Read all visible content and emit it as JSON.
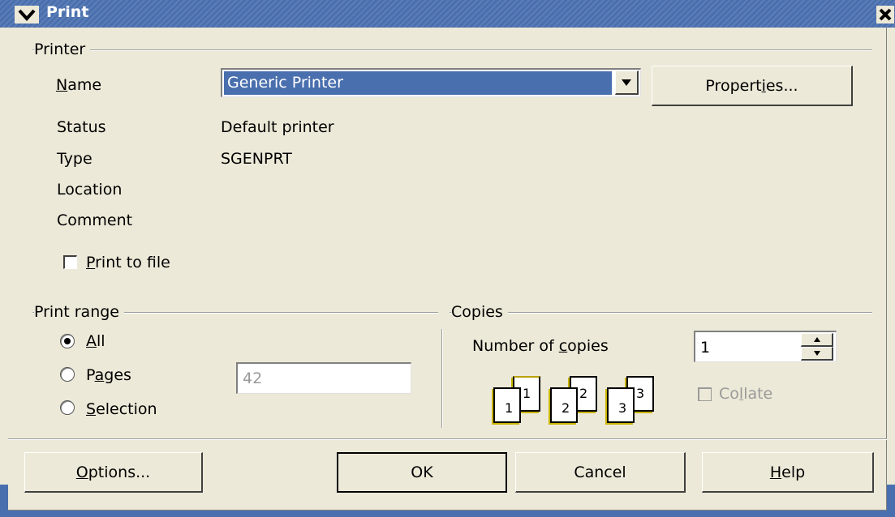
{
  "window": {
    "title": "Print"
  },
  "printer": {
    "group_label": "Printer",
    "name_label": "Name",
    "name_value": "Generic Printer",
    "properties_button": "Properties...",
    "status_label": "Status",
    "status_value": "Default printer",
    "type_label": "Type",
    "type_value": "SGENPRT",
    "location_label": "Location",
    "comment_label": "Comment",
    "print_to_file_label": "Print to file",
    "print_to_file_checked": false
  },
  "print_range": {
    "group_label": "Print range",
    "options": [
      {
        "label": "All",
        "selected": true
      },
      {
        "label": "Pages",
        "selected": false
      },
      {
        "label": "Selection",
        "selected": false
      }
    ],
    "pages_value": "42"
  },
  "copies": {
    "group_label": "Copies",
    "number_label": "Number of copies",
    "number_value": "1",
    "collate_label": "Collate",
    "collate_checked": false,
    "page_stack_numbers": [
      "1",
      "2",
      "3"
    ]
  },
  "buttons": {
    "options": "Options...",
    "ok": "OK",
    "cancel": "Cancel",
    "help": "Help"
  },
  "colors": {
    "titlebar": "#4a6fae",
    "selection": "#4a6fae",
    "dialog_bg": "#ece9d8"
  }
}
